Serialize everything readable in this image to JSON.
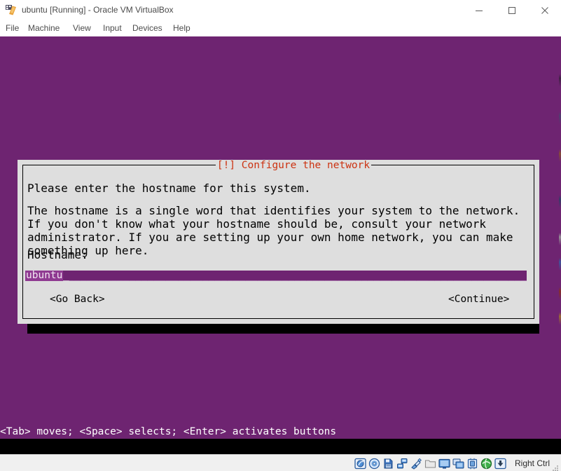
{
  "window": {
    "title": "ubuntu [Running] - Oracle VM VirtualBox",
    "icon": "virtualbox-logo-icon",
    "controls": {
      "minimize": "minimize-icon",
      "maximize": "maximize-icon",
      "close": "close-icon"
    }
  },
  "menubar": {
    "items": [
      {
        "label": "File"
      },
      {
        "label": "Machine"
      },
      {
        "label": "View"
      },
      {
        "label": "Input"
      },
      {
        "label": "Devices"
      },
      {
        "label": "Help"
      }
    ]
  },
  "guest": {
    "background_color": "#6e2471",
    "dialog": {
      "title": "[!] Configure the network",
      "title_color": "#cc3311",
      "background_color": "#dedede",
      "paragraphs": [
        "Please enter the hostname for this system.",
        "The hostname is a single word that identifies your system to the network. If you don't know what your hostname should be, consult your network administrator. If you are setting up your own home network, you can make something up here."
      ],
      "field_label": "Hostname:",
      "input": {
        "value": "ubuntu",
        "caret": "_",
        "fill": "_____________________________________________________________________________________________________",
        "background_color": "#6e2471",
        "selection_color": "#8f3a91"
      },
      "buttons": [
        {
          "label": "<Go Back>"
        },
        {
          "label": "<Continue>"
        }
      ]
    },
    "status_line": "<Tab> moves; <Space> selects; <Enter> activates buttons"
  },
  "statusbar": {
    "icons": [
      "hard-disk-icon",
      "optical-disk-icon",
      "floppy-disk-icon",
      "network-icon",
      "usb-icon",
      "shared-folders-icon",
      "display-icon",
      "video-capture-icon",
      "cpu-icon",
      "3d-acceleration-icon",
      "mouse-capture-icon"
    ],
    "host_key_label": "Right Ctrl",
    "resize_grip": "resize-grip-icon"
  }
}
